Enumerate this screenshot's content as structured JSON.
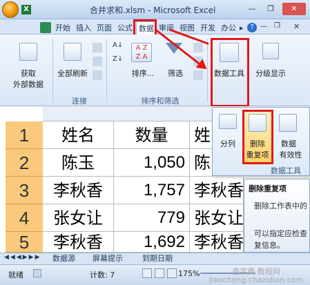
{
  "window": {
    "title": "合并求和.xlsm - Microsoft Excel",
    "minimize": "—",
    "restore": "❐",
    "close": "✕"
  },
  "tabs": [
    "开始",
    "插入",
    "页面",
    "公式",
    "数据",
    "审阅",
    "视图",
    "开发",
    "办公"
  ],
  "tabs_overflow": "▸",
  "ribbon": {
    "get_external_data": [
      "获取",
      "外部数据"
    ],
    "refresh_all": "全部刷新",
    "connections_group": "连接",
    "sort": "排序...",
    "filter": "筛选",
    "sort_filter_group": "排序和筛选",
    "data_tools": "数据工具",
    "outline": "分级显示"
  },
  "data_tools_panel": {
    "text_to_columns": "分列",
    "remove_duplicates": [
      "删除",
      "重复项"
    ],
    "data_validation": [
      "数据",
      "有效性"
    ],
    "group_label": "数据工具"
  },
  "tooltip": {
    "title": "删除重复项",
    "line1": "删除工作表中的",
    "line2": "可以指定应检查",
    "line3": "复信息。"
  },
  "sheet": {
    "rows": [
      {
        "num": "1",
        "name": "姓名",
        "qty": "数量",
        "c": "姓"
      },
      {
        "num": "2",
        "name": "陈玉",
        "qty": "1,050",
        "c": "陈"
      },
      {
        "num": "3",
        "name": "李秋香",
        "qty": "1,757",
        "c": "李秋香"
      },
      {
        "num": "4",
        "name": "张女让",
        "qty": "779",
        "c": "张女让"
      },
      {
        "num": "5",
        "name": "李秋香",
        "qty": "1,692",
        "c": "李秋香"
      }
    ]
  },
  "sheet_tabs": [
    "数据源",
    "屏幕提示",
    "到期日期"
  ],
  "status": {
    "ready": "就绪",
    "count": "计数: 7",
    "zoom": "175%"
  },
  "watermark": [
    "查字典 教程网",
    "jiaocheng.chazidian.com"
  ]
}
